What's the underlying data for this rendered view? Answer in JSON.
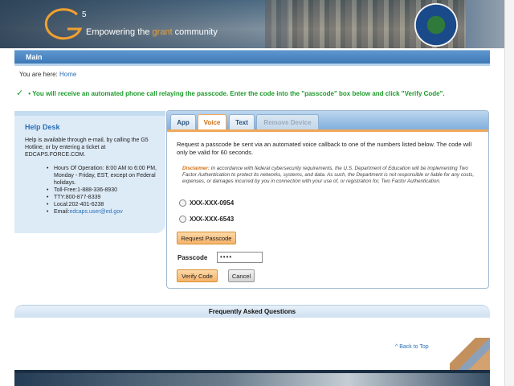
{
  "header": {
    "logo_mark": "G",
    "logo_superscript": "5",
    "tagline_before": "Empowering the ",
    "tagline_accent": "grant",
    "tagline_after": " community",
    "seal_icon": "department-of-education-seal-icon"
  },
  "main_bar": {
    "title": "Main"
  },
  "breadcrumb": {
    "prefix": "You are here: ",
    "home": "Home"
  },
  "notice": {
    "text": "You will receive an automated phone call relaying the passcode. Enter the code into the \"passcode\" box below and click \"Verify Code\"."
  },
  "help_desk": {
    "title": "Help Desk",
    "description": "Help is available through e-mail, by calling the G5 Hotline, or by entering a ticket at EDCAPS.FORCE.COM.",
    "items": [
      "Hours Of Operation: 8:00 AM to 6:00 PM, Monday - Friday, EST, except on Federal holidays.",
      "Toll-Free:1-888-336-8930",
      "TTY:800-877-8339",
      "Local:202-401-6238"
    ],
    "email_label": "Email:",
    "email": "edcaps.user@ed.gov"
  },
  "tabs": [
    {
      "label": "App",
      "state": "normal"
    },
    {
      "label": "Voice",
      "state": "active"
    },
    {
      "label": "Text",
      "state": "normal"
    },
    {
      "label": "Remove Device",
      "state": "disabled"
    }
  ],
  "voice": {
    "instructions": "Request a passcode be sent via an automated voice callback to one of the numbers listed below. The code will only be valid for 60 seconds.",
    "disclaimer_label": "Disclaimer:",
    "disclaimer_text": " In accordance with federal cybersecurity requirements, the U.S. Department of Education will be implementing Two Factor Authentication to protect its networks, systems, and data. As such, the Department is not responsible or liable for any costs, expenses, or damages incurred by you in connection with your use of, or registration for, Two Factor Authentication.",
    "phones": [
      "XXX-XXX-0954",
      "XXX-XXX-6543"
    ],
    "request_button": "Request Passcode",
    "passcode_label": "Passcode",
    "passcode_value": "••••",
    "verify_button": "Verify Code",
    "cancel_button": "Cancel"
  },
  "faq": {
    "title": "Frequently Asked Questions",
    "back_to_top": "^ Back to Top"
  }
}
